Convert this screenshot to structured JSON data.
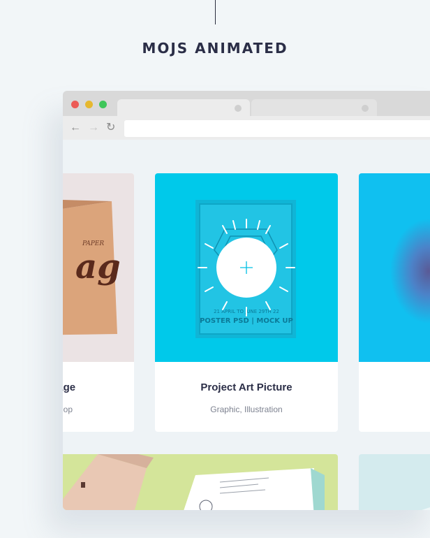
{
  "section_title": "MOJS ANIMATED",
  "browser": {
    "traffic_lights": [
      "#ec5b57",
      "#e6b82f",
      "#3ec65a"
    ],
    "nav_icons": [
      "back-arrow-icon",
      "forward-arrow-icon",
      "reload-icon"
    ],
    "address_value": ""
  },
  "portfolio": {
    "items": [
      {
        "title": "kage",
        "category": "shop"
      },
      {
        "title": "Project Art Picture",
        "category": "Graphic, Illustration"
      },
      {
        "title": "",
        "category": ""
      }
    ],
    "poster": {
      "line1": "21 APRIL TO JUNE 29TH 22",
      "line2": "POSTER PSD | MOCK UP"
    },
    "bag": {
      "small": "PAPER",
      "big": "ag"
    }
  },
  "colors": {
    "accent_cyan": "#00c9ea",
    "bag_bg": "#ebe3e4",
    "green_bg": "#d4e59a",
    "gradient_card": "#10c0f0"
  }
}
